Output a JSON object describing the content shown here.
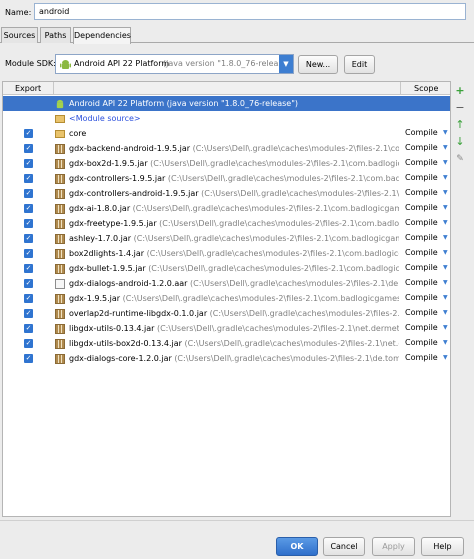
{
  "name": {
    "label": "Name:",
    "value": "android"
  },
  "tabs": [
    {
      "label": "Sources"
    },
    {
      "label": "Paths"
    },
    {
      "label": "Dependencies"
    }
  ],
  "sdk": {
    "label": "Module SDK:",
    "name": "Android API 22 Platform",
    "version": "(java version \"1.8.0_76-release\")",
    "new_label": "New...",
    "edit_label": "Edit"
  },
  "table": {
    "header_export": "Export",
    "header_scope": "Scope",
    "rows": [
      {
        "name": "Android API 22 Platform (java version \"1.8.0_76-release\")",
        "path": "",
        "scope": "",
        "checked": false,
        "icon": "android-icon",
        "selected": true
      },
      {
        "name": "<Module source>",
        "path": "",
        "scope": "",
        "checked": false,
        "icon": "folder-icon"
      },
      {
        "name": "core",
        "path": "",
        "scope": "Compile",
        "checked": true,
        "icon": "folder-icon"
      },
      {
        "name": "gdx-backend-android-1.9.5.jar",
        "path": "(C:\\Users\\Dell\\.gradle\\caches\\modules-2\\files-2.1\\com.badlo",
        "scope": "Compile",
        "checked": true,
        "icon": "jar-icon"
      },
      {
        "name": "gdx-box2d-1.9.5.jar",
        "path": "(C:\\Users\\Dell\\.gradle\\caches\\modules-2\\files-2.1\\com.badlogicgames.",
        "scope": "Compile",
        "checked": true,
        "icon": "jar-icon"
      },
      {
        "name": "gdx-controllers-1.9.5.jar",
        "path": "(C:\\Users\\Dell\\.gradle\\caches\\modules-2\\files-2.1\\com.badlogicgam",
        "scope": "Compile",
        "checked": true,
        "icon": "jar-icon"
      },
      {
        "name": "gdx-controllers-android-1.9.5.jar",
        "path": "(C:\\Users\\Dell\\.gradle\\caches\\modules-2\\files-2.1\\com.bac",
        "scope": "Compile",
        "checked": true,
        "icon": "jar-icon"
      },
      {
        "name": "gdx-ai-1.8.0.jar",
        "path": "(C:\\Users\\Dell\\.gradle\\caches\\modules-2\\files-2.1\\com.badlogicgames.gdx\\",
        "scope": "Compile",
        "checked": true,
        "icon": "jar-icon"
      },
      {
        "name": "gdx-freetype-1.9.5.jar",
        "path": "(C:\\Users\\Dell\\.gradle\\caches\\modules-2\\files-2.1\\com.badlogicgames",
        "scope": "Compile",
        "checked": true,
        "icon": "jar-icon"
      },
      {
        "name": "ashley-1.7.0.jar",
        "path": "(C:\\Users\\Dell\\.gradle\\caches\\modules-2\\files-2.1\\com.badlogicgames.ashle",
        "scope": "Compile",
        "checked": true,
        "icon": "jar-icon"
      },
      {
        "name": "box2dlights-1.4.jar",
        "path": "(C:\\Users\\Dell\\.gradle\\caches\\modules-2\\files-2.1\\com.badlogicgames.",
        "scope": "Compile",
        "checked": true,
        "icon": "jar-icon"
      },
      {
        "name": "gdx-bullet-1.9.5.jar",
        "path": "(C:\\Users\\Dell\\.gradle\\caches\\modules-2\\files-2.1\\com.badlogicgames.g",
        "scope": "Compile",
        "checked": true,
        "icon": "jar-icon"
      },
      {
        "name": "gdx-dialogs-android-1.2.0.aar",
        "path": "(C:\\Users\\Dell\\.gradle\\caches\\modules-2\\files-2.1\\de.tomgrill",
        "scope": "Compile",
        "checked": true,
        "icon": "aar-icon"
      },
      {
        "name": "gdx-1.9.5.jar",
        "path": "(C:\\Users\\Dell\\.gradle\\caches\\modules-2\\files-2.1\\com.badlogicgames.gdx\\gd",
        "scope": "Compile",
        "checked": true,
        "icon": "jar-icon"
      },
      {
        "name": "overlap2d-runtime-libgdx-0.1.0.jar",
        "path": "(C:\\Users\\Dell\\.gradle\\caches\\modules-2\\files-2.1\\com.u",
        "scope": "Compile",
        "checked": true,
        "icon": "jar-icon"
      },
      {
        "name": "libgdx-utils-0.13.4.jar",
        "path": "(C:\\Users\\Dell\\.gradle\\caches\\modules-2\\files-2.1\\net.dermetfan.libgd",
        "scope": "Compile",
        "checked": true,
        "icon": "jar-icon"
      },
      {
        "name": "libgdx-utils-box2d-0.13.4.jar",
        "path": "(C:\\Users\\Dell\\.gradle\\caches\\modules-2\\files-2.1\\net.dermetfa",
        "scope": "Compile",
        "checked": true,
        "icon": "jar-icon"
      },
      {
        "name": "gdx-dialogs-core-1.2.0.jar",
        "path": "(C:\\Users\\Dell\\.gradle\\caches\\modules-2\\files-2.1\\de.tomgrill.gdxd",
        "scope": "Compile",
        "checked": true,
        "icon": "jar-icon"
      }
    ]
  },
  "toolbar": {
    "add": "+",
    "remove": "−",
    "up": "↑",
    "down": "↓",
    "edit": "✎"
  },
  "buttons": {
    "ok": "OK",
    "cancel": "Cancel",
    "apply": "Apply",
    "help": "Help"
  },
  "colors": {
    "accent": "#3b74c9",
    "selection": "#3b74c9",
    "checkbox": "#2f74d0"
  }
}
